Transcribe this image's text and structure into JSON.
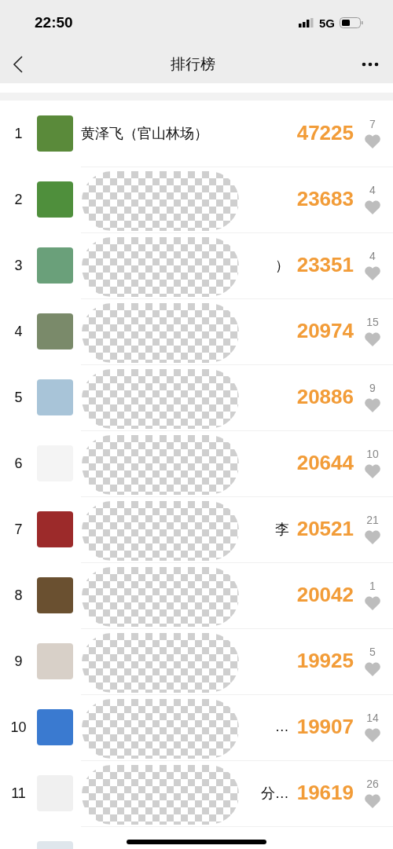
{
  "status_bar": {
    "time": "22:50",
    "network": "5G"
  },
  "nav": {
    "title": "排行榜"
  },
  "rows": [
    {
      "rank": "1",
      "name": "黄泽飞（官山林场）",
      "redacted": false,
      "score": "47225",
      "likes": "7"
    },
    {
      "rank": "2",
      "redacted": true,
      "score": "23683",
      "likes": "4"
    },
    {
      "rank": "3",
      "name": "）",
      "redacted": true,
      "score": "23351",
      "likes": "4"
    },
    {
      "rank": "4",
      "redacted": true,
      "score": "20974",
      "likes": "15"
    },
    {
      "rank": "5",
      "redacted": true,
      "score": "20886",
      "likes": "9"
    },
    {
      "rank": "6",
      "redacted": true,
      "score": "20644",
      "likes": "10"
    },
    {
      "rank": "7",
      "name": "李",
      "redacted": true,
      "score": "20521",
      "likes": "21"
    },
    {
      "rank": "8",
      "redacted": true,
      "score": "20042",
      "likes": "1"
    },
    {
      "rank": "9",
      "redacted": true,
      "score": "19925",
      "likes": "5"
    },
    {
      "rank": "10",
      "name": "…",
      "redacted": true,
      "score": "19907",
      "likes": "14"
    },
    {
      "rank": "11",
      "name": "分…",
      "redacted": true,
      "score": "19619",
      "likes": "26"
    }
  ]
}
